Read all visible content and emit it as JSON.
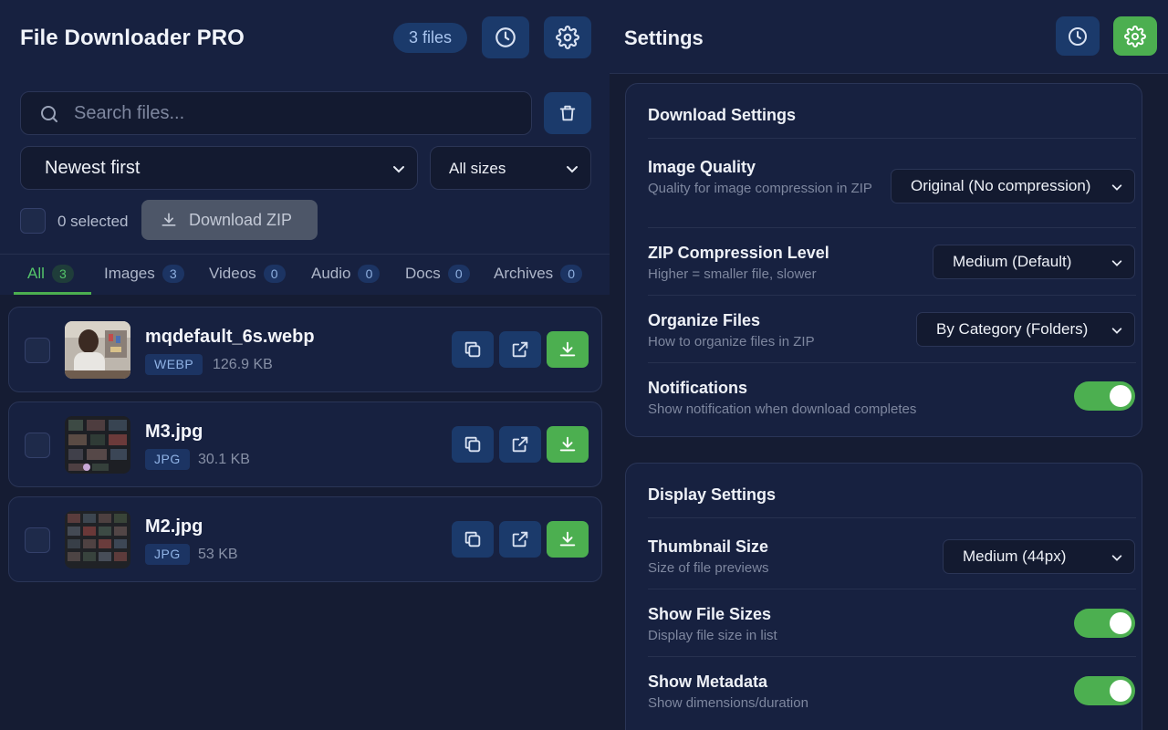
{
  "app": {
    "title": "File Downloader PRO",
    "file_count_badge": "3 files"
  },
  "toolbar": {
    "search_placeholder": "Search files...",
    "sort_selected": "Newest first",
    "size_filter_selected": "All sizes",
    "selected_count_label": "0 selected",
    "download_zip_label": "Download ZIP"
  },
  "tabs": [
    {
      "label": "All",
      "count": "3",
      "active": true
    },
    {
      "label": "Images",
      "count": "3"
    },
    {
      "label": "Videos",
      "count": "0"
    },
    {
      "label": "Audio",
      "count": "0"
    },
    {
      "label": "Docs",
      "count": "0"
    },
    {
      "label": "Archives",
      "count": "0"
    }
  ],
  "files": [
    {
      "name": "mqdefault_6s.webp",
      "ext": "WEBP",
      "size": "126.9 KB"
    },
    {
      "name": "M3.jpg",
      "ext": "JPG",
      "size": "30.1 KB"
    },
    {
      "name": "M2.jpg",
      "ext": "JPG",
      "size": "53 KB"
    }
  ],
  "settings": {
    "title": "Settings",
    "download": {
      "heading": "Download Settings",
      "image_quality": {
        "label": "Image Quality",
        "desc": "Quality for image compression in ZIP",
        "value": "Original (No compression)"
      },
      "zip_level": {
        "label": "ZIP Compression Level",
        "desc": "Higher = smaller file, slower",
        "value": "Medium (Default)"
      },
      "organize": {
        "label": "Organize Files",
        "desc": "How to organize files in ZIP",
        "value": "By Category (Folders)"
      },
      "notifications": {
        "label": "Notifications",
        "desc": "Show notification when download completes",
        "enabled": true
      }
    },
    "display": {
      "heading": "Display Settings",
      "thumb_size": {
        "label": "Thumbnail Size",
        "desc": "Size of file previews",
        "value": "Medium (44px)"
      },
      "show_sizes": {
        "label": "Show File Sizes",
        "desc": "Display file size in list",
        "enabled": true
      },
      "show_meta": {
        "label": "Show Metadata",
        "desc": "Show dimensions/duration",
        "enabled": true
      }
    }
  },
  "colors": {
    "accent_green": "#4caf50",
    "button_blue": "#1b3a6b",
    "background": "#151c33",
    "panel": "#172140"
  },
  "icons": {
    "history": "clock-icon",
    "settings": "gear-icon",
    "search": "search-icon",
    "delete": "trash-icon",
    "copy": "copy-icon",
    "open": "external-link-icon",
    "download": "download-icon"
  }
}
